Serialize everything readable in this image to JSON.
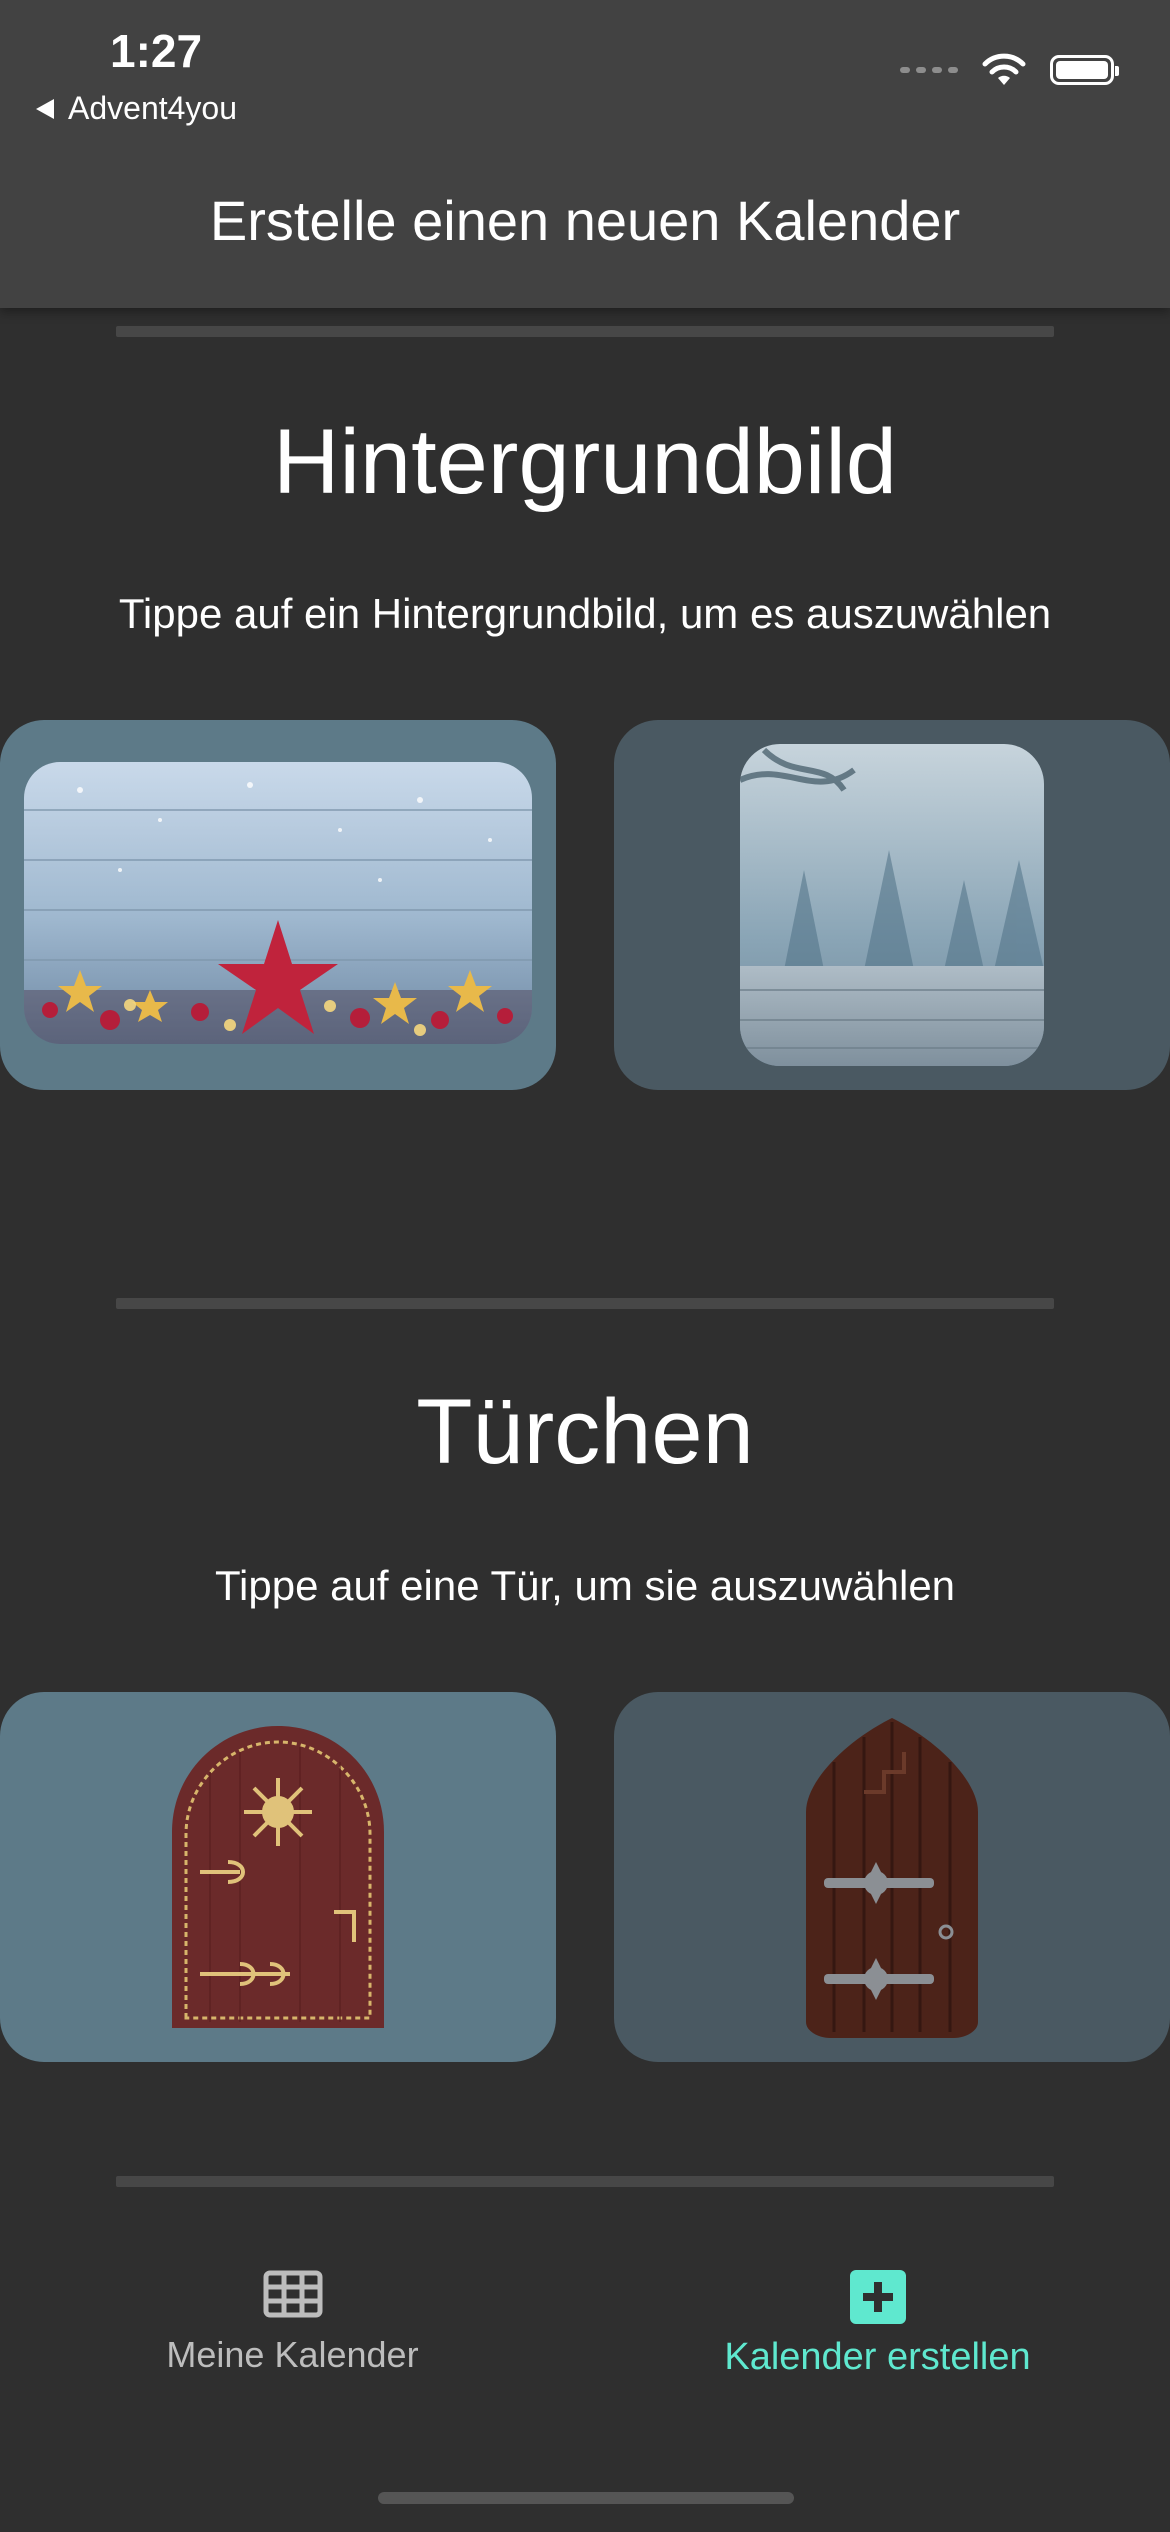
{
  "status": {
    "time": "1:27",
    "back_app": "Advent4you"
  },
  "header": {
    "title": "Erstelle einen neuen Kalender"
  },
  "background_section": {
    "title": "Hintergrundbild",
    "hint": "Tippe auf ein Hintergrundbild, um es auszuwählen",
    "options": [
      {
        "name": "winter-wood-star-background",
        "selected": true
      },
      {
        "name": "snowy-forest-background",
        "selected": false
      }
    ]
  },
  "door_section": {
    "title": "Türchen",
    "hint": "Tippe auf eine Tür, um sie auszuwählen",
    "options": [
      {
        "name": "arched-door-gold-ornament",
        "selected": true
      },
      {
        "name": "pointed-door-iron-hinges",
        "selected": false
      }
    ]
  },
  "bottom_nav": {
    "items": [
      {
        "label": "Meine Kalender",
        "icon": "grid-icon",
        "active": false
      },
      {
        "label": "Kalender erstellen",
        "icon": "plus-square-icon",
        "active": true
      }
    ],
    "active_color": "#5fe8cf",
    "inactive_color": "#bdbdbd"
  }
}
